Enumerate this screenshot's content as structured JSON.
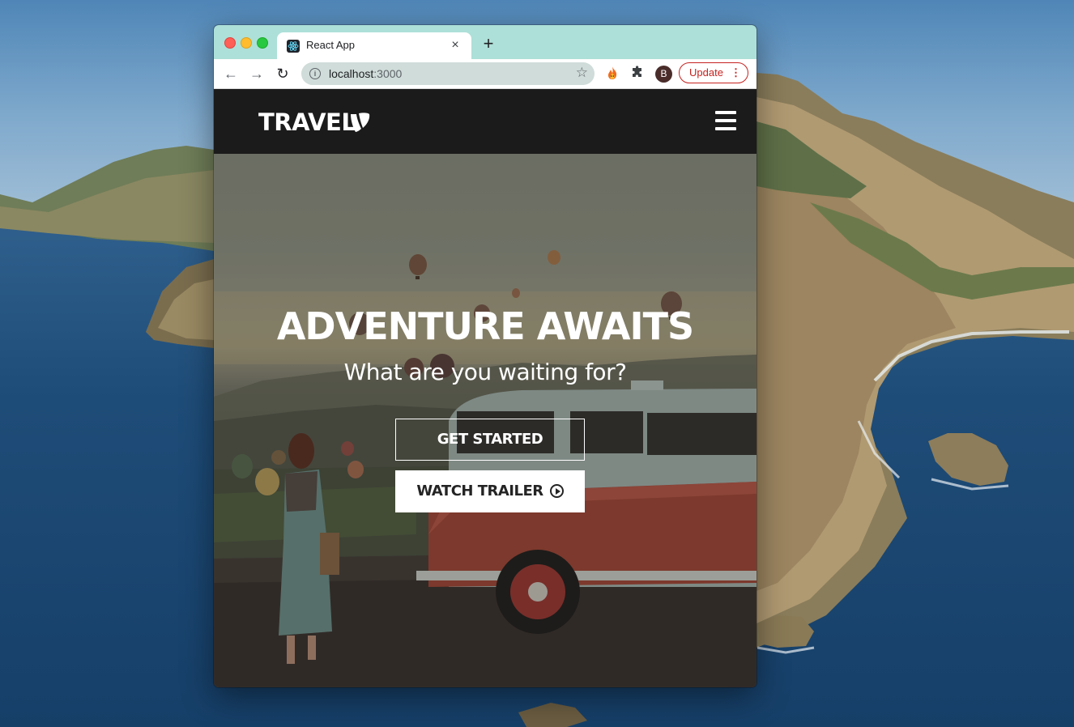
{
  "browser": {
    "tab_title": "React App",
    "tab_close": "×",
    "new_tab": "+",
    "url_host": "localhost",
    "url_port": ":3000",
    "avatar_initial": "B",
    "update_label": "Update",
    "update_menu": "⋮",
    "back_glyph": "←",
    "forward_glyph": "→",
    "reload_glyph": "↻",
    "star_glyph": "☆",
    "info_glyph": "i",
    "puzzle_glyph": "✚",
    "fire_glyph": "🔥"
  },
  "site": {
    "logo_text": "TRAVEL",
    "hero_title": "ADVENTURE AWAITS",
    "hero_subtitle": "What are you waiting for?",
    "get_started_label": "GET STARTED",
    "watch_trailer_label": "WATCH TRAILER"
  },
  "colors": {
    "tabstrip": "#ade0d8",
    "navbar": "#1c1b1b",
    "update_accent": "#c5221f"
  }
}
